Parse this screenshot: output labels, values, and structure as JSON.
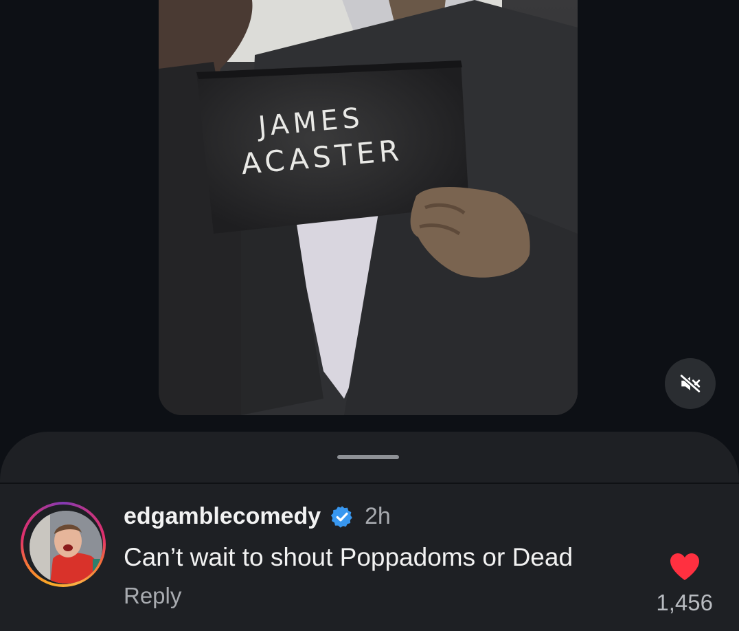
{
  "video": {
    "sign_line_1": "JAMES",
    "sign_line_2": "ACASTER",
    "mute_icon": "speaker-muted-icon"
  },
  "comment": {
    "username": "edgamblecomedy",
    "verified_icon": "verified-badge-icon",
    "timestamp": "2h",
    "text": "Can’t wait to shout Poppadoms or Dead",
    "reply_label": "Reply",
    "like_icon": "heart-filled-icon",
    "like_count": "1,456"
  },
  "colors": {
    "background": "#0d1015",
    "sheet": "#1e2024",
    "verified_blue": "#3897f0",
    "heart_red": "#ff3040"
  }
}
